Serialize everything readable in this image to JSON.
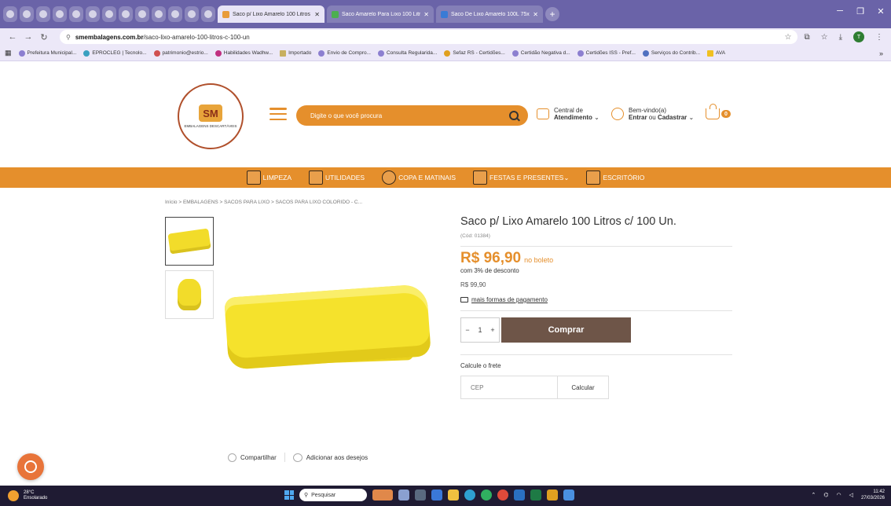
{
  "browser": {
    "tabs": [
      {
        "title": "Saco p/ Lixo Amarelo 100 Litros c/",
        "active": true
      },
      {
        "title": "Saco Amarelo Para Lixo 100 Litros",
        "active": false
      },
      {
        "title": "Saco De Lixo Amarelo 100L 75x",
        "active": false
      }
    ],
    "address": {
      "host": "smembalagens.com.br",
      "path": "/saco-lixo-amarelo-100-litros-c-100-un"
    },
    "profile_initial": "T",
    "bookmarks": [
      "Prefeitura Municipal...",
      "EPROCLEG | Tecnolo...",
      "patrimonio@estrio...",
      "Habilidades Wadhw...",
      "Importado",
      "Envio de Compro...",
      "Consulta Regularida...",
      "Sefaz RS - Certidões...",
      "Certidão Negativa d...",
      "Certidões ISS - Pref...",
      "Serviços do Contrib...",
      "AVA"
    ]
  },
  "header": {
    "logo_text": "SM",
    "logo_subtitle": "EMBALAGENS DESCARTÁVEIS",
    "search_placeholder": "Digite o que você procura",
    "central_line1": "Central de",
    "central_line2": "Atendimento",
    "user_line1": "Bem-vindo(a)",
    "user_login": "Entrar",
    "user_or": "ou",
    "user_register": "Cadastrar",
    "cart_count": "0"
  },
  "categories": [
    "LIMPEZA",
    "UTILIDADES",
    "COPA E MATINAIS",
    "FESTAS E PRESENTES",
    "ESCRITÓRIO"
  ],
  "breadcrumb": "Início  >  EMBALAGENS  >  SACOS PARA LIXO  >  SACOS PARA LIXO COLORIDO - C...",
  "product": {
    "title": "Saco p/ Lixo Amarelo 100 Litros c/ 100 Un.",
    "code": "(Cód: 01384)",
    "price": "R$ 96,90",
    "price_note": "no boleto",
    "discount": "com 3% de desconto",
    "old_price": "R$ 99,90",
    "more_payment": "mais formas de pagamento",
    "qty_minus": "−",
    "qty": "1",
    "qty_plus": "+",
    "buy_label": "Comprar",
    "freight_label": "Calcule o frete",
    "cep_placeholder": "CEP",
    "calc_label": "Calcular",
    "share_label": "Compartilhar",
    "wishlist_label": "Adicionar aos desejos"
  },
  "taskbar": {
    "temp": "28°C",
    "weather": "Ensolarado",
    "search_placeholder": "Pesquisar",
    "time": "11:42",
    "date": "27/03/2026"
  },
  "colors": {
    "accent": "#e58f2c",
    "buy": "#6e5548",
    "tabstrip": "#6a63a8"
  }
}
